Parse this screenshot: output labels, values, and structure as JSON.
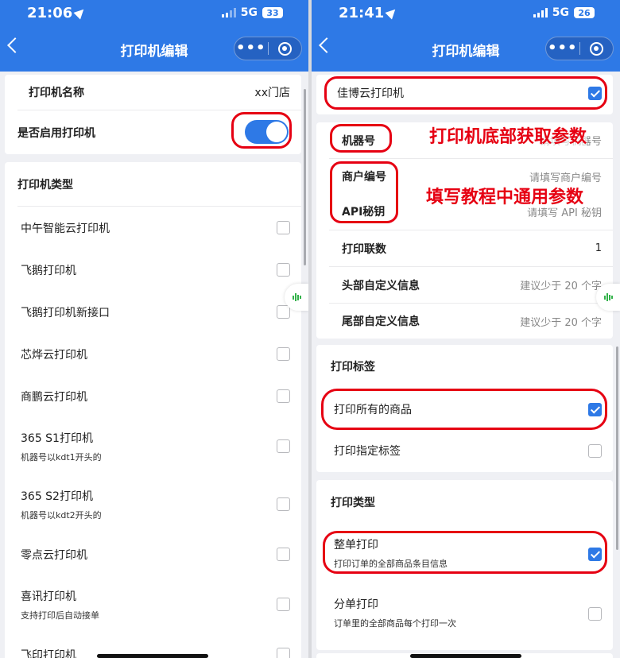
{
  "left": {
    "status": {
      "time": "21:06",
      "network": "5G",
      "battery": "33"
    },
    "nav": {
      "title": "打印机编辑"
    },
    "printer_name": {
      "label": "打印机名称",
      "value": "xx门店"
    },
    "enable_printer": {
      "label": "是否启用打印机",
      "enabled": true
    },
    "printer_type": {
      "title": "打印机类型",
      "items": [
        {
          "label": "中午智能云打印机",
          "desc": ""
        },
        {
          "label": "飞鹅打印机",
          "desc": ""
        },
        {
          "label": "飞鹅打印机新接口",
          "desc": ""
        },
        {
          "label": "芯烨云打印机",
          "desc": ""
        },
        {
          "label": "商鹏云打印机",
          "desc": ""
        },
        {
          "label": "365 S1打印机",
          "desc": "机器号以kdt1开头的"
        },
        {
          "label": "365 S2打印机",
          "desc": "机器号以kdt2开头的"
        },
        {
          "label": "零点云打印机",
          "desc": ""
        },
        {
          "label": "喜讯打印机",
          "desc": "支持打印后自动接单"
        },
        {
          "label": "飞印打印机",
          "desc": ""
        }
      ]
    }
  },
  "right": {
    "status": {
      "time": "21:41",
      "network": "5G",
      "battery": "26"
    },
    "nav": {
      "title": "打印机编辑"
    },
    "selected_printer": {
      "label": "佳博云打印机",
      "checked": true
    },
    "params": {
      "machine_no": {
        "label": "机器号",
        "placeholder": "请填写机器号"
      },
      "merchant_no": {
        "label": "商户编号",
        "placeholder": "请填写商户编号"
      },
      "api_key": {
        "label": "API秘钥",
        "placeholder": "请填写 API 秘钥"
      },
      "copies": {
        "label": "打印联数",
        "value": "1"
      },
      "header_info": {
        "label": "头部自定义信息",
        "placeholder": "建议少于 20 个字"
      },
      "footer_info": {
        "label": "尾部自定义信息",
        "placeholder": "建议少于 20 个字"
      }
    },
    "print_tags": {
      "title": "打印标签",
      "all_goods": {
        "label": "打印所有的商品",
        "checked": true
      },
      "specified_tags": {
        "label": "打印指定标签",
        "checked": false
      }
    },
    "print_type": {
      "title": "打印类型",
      "whole": {
        "label": "整单打印",
        "desc": "打印订单的全部商品条目信息",
        "checked": true
      },
      "split": {
        "label": "分单打印",
        "desc": "订单里的全部商品每个打印一次",
        "checked": false
      }
    },
    "annotations": {
      "bottom_params": "打印机底部获取参数",
      "tutorial_params": "填写教程中通用参数"
    }
  },
  "colors": {
    "primary": "#2e79e6",
    "annotation": "#e60012"
  }
}
